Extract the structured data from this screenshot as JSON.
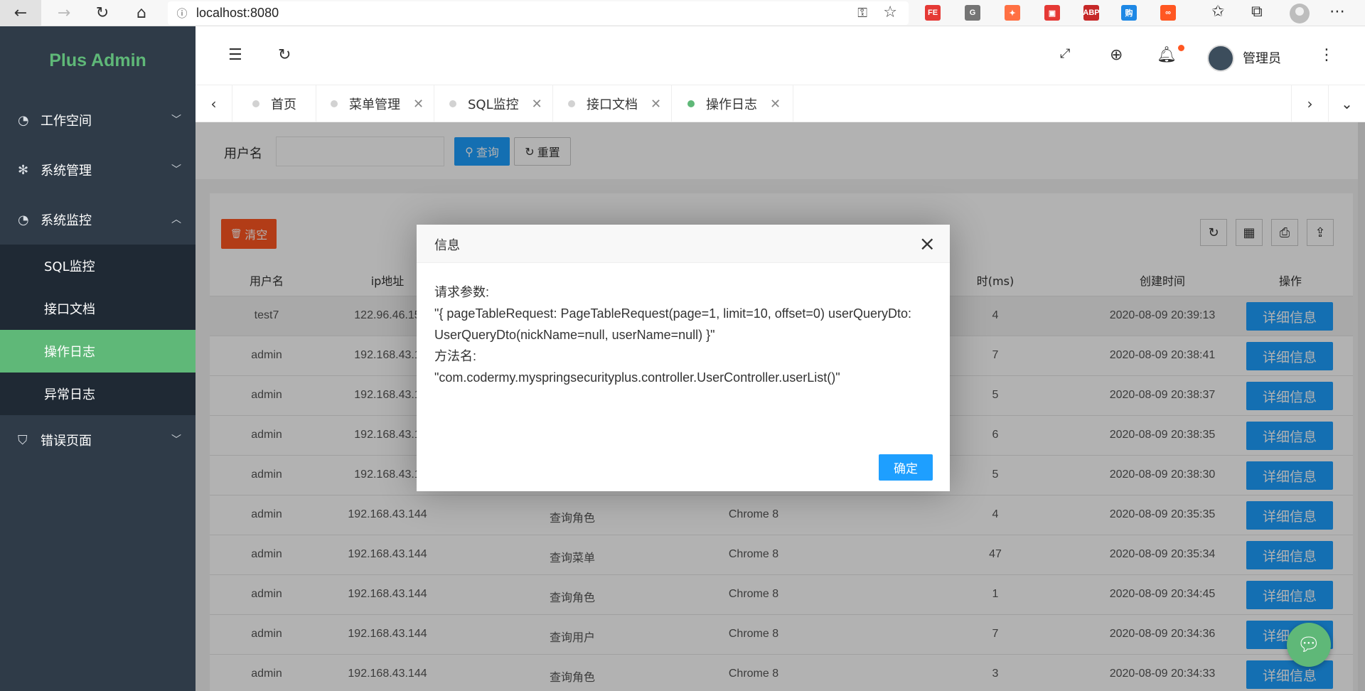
{
  "browser": {
    "url": "localhost:8080",
    "extensions": [
      {
        "label": "FE",
        "color": "#e53935",
        "name": "fe-extension-icon"
      },
      {
        "label": "G",
        "color": "#757575",
        "name": "g-extension-icon"
      },
      {
        "label": "✦",
        "color": "#ff7043",
        "name": "network-extension-icon"
      },
      {
        "label": "▣",
        "color": "#e53935",
        "name": "cube-extension-icon"
      },
      {
        "label": "ABP",
        "color": "#c62828",
        "name": "adblock-extension-icon"
      },
      {
        "label": "购",
        "color": "#1e88e5",
        "name": "shop-extension-icon"
      },
      {
        "label": "∞",
        "color": "#ff5722",
        "name": "infinity-extension-icon"
      }
    ]
  },
  "sidebar": {
    "logo": "Plus Admin",
    "menu": [
      {
        "label": "工作空间",
        "icon": "gauge-icon",
        "expanded": false
      },
      {
        "label": "系统管理",
        "icon": "gear-icon",
        "expanded": false
      },
      {
        "label": "系统监控",
        "icon": "gauge-icon",
        "expanded": true
      },
      {
        "label": "错误页面",
        "icon": "shield-icon",
        "expanded": false
      }
    ],
    "submenu": [
      "SQL监控",
      "接口文档",
      "操作日志",
      "异常日志"
    ],
    "active_submenu": "操作日志"
  },
  "header": {
    "user_name": "管理员"
  },
  "tabs": [
    {
      "label": "首页",
      "active": false,
      "closable": false
    },
    {
      "label": "菜单管理",
      "active": false,
      "closable": true
    },
    {
      "label": "SQL监控",
      "active": false,
      "closable": true
    },
    {
      "label": "接口文档",
      "active": false,
      "closable": true
    },
    {
      "label": "操作日志",
      "active": true,
      "closable": true
    }
  ],
  "search": {
    "label": "用户名",
    "value": "",
    "query_label": "查询",
    "reset_label": "重置"
  },
  "table": {
    "clear_label": "清空",
    "headers": [
      "用户名",
      "ip地址",
      "",
      "",
      "时(ms)",
      "创建时间",
      "操作"
    ],
    "detail_label": "详细信息",
    "rows": [
      {
        "user": "test7",
        "ip": "122.96.46.15",
        "op": "",
        "browser": "",
        "ms": "4",
        "time": "2020-08-09 20:39:13"
      },
      {
        "user": "admin",
        "ip": "192.168.43.1",
        "op": "",
        "browser": "",
        "ms": "7",
        "time": "2020-08-09 20:38:41"
      },
      {
        "user": "admin",
        "ip": "192.168.43.1",
        "op": "",
        "browser": "",
        "ms": "5",
        "time": "2020-08-09 20:38:37"
      },
      {
        "user": "admin",
        "ip": "192.168.43.1",
        "op": "",
        "browser": "",
        "ms": "6",
        "time": "2020-08-09 20:38:35"
      },
      {
        "user": "admin",
        "ip": "192.168.43.1",
        "op": "",
        "browser": "",
        "ms": "5",
        "time": "2020-08-09 20:38:30"
      },
      {
        "user": "admin",
        "ip": "192.168.43.144",
        "op": "查询角色",
        "browser": "Chrome 8",
        "ms": "4",
        "time": "2020-08-09 20:35:35"
      },
      {
        "user": "admin",
        "ip": "192.168.43.144",
        "op": "查询菜单",
        "browser": "Chrome 8",
        "ms": "47",
        "time": "2020-08-09 20:35:34"
      },
      {
        "user": "admin",
        "ip": "192.168.43.144",
        "op": "查询角色",
        "browser": "Chrome 8",
        "ms": "1",
        "time": "2020-08-09 20:34:45"
      },
      {
        "user": "admin",
        "ip": "192.168.43.144",
        "op": "查询用户",
        "browser": "Chrome 8",
        "ms": "7",
        "time": "2020-08-09 20:34:36"
      },
      {
        "user": "admin",
        "ip": "192.168.43.144",
        "op": "查询角色",
        "browser": "Chrome 8",
        "ms": "3",
        "time": "2020-08-09 20:34:33"
      }
    ]
  },
  "modal": {
    "title": "信息",
    "params_label": "请求参数:",
    "params_value": "\"{ pageTableRequest: PageTableRequest(page=1, limit=10, offset=0) userQueryDto: UserQueryDto(nickName=null, userName=null) }\"",
    "method_label": "方法名:",
    "method_value": "\"com.codermy.myspringsecurityplus.controller.UserController.userList()\"",
    "ok_label": "确定"
  }
}
